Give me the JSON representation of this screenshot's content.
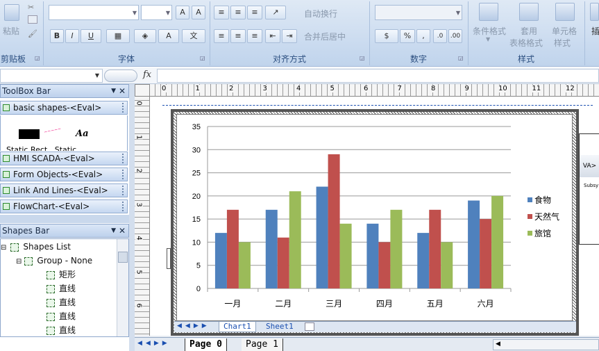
{
  "ribbon": {
    "clipboard": {
      "paste": "粘贴",
      "label": "剪贴板"
    },
    "font": {
      "label": "字体",
      "bold": "B",
      "italic": "I",
      "underline": "U"
    },
    "alignment": {
      "wrap_text": "自动换行",
      "merge_center": "合并后居中",
      "label": "对齐方式"
    },
    "number": {
      "percent": "%",
      "label": "数字"
    },
    "styles": {
      "conditional": "条件格式",
      "table": "套用",
      "table2": "表格格式",
      "cell": "单元格",
      "cell2": "样式",
      "label": "样式"
    },
    "insert": "插"
  },
  "formula_bar": {
    "fx": "fx"
  },
  "toolbox": {
    "title": "ToolBox Bar",
    "items": [
      {
        "label": "basic shapes-<Eval>"
      },
      {
        "label": "HMI SCADA-<Eval>"
      },
      {
        "label": "Form Objects-<Eval>"
      },
      {
        "label": "Link And Lines-<Eval>"
      },
      {
        "label": "FlowChart-<Eval>"
      }
    ],
    "preview_text": "Aa",
    "preview_caption": "Static Rect   Static"
  },
  "shapes": {
    "title": "Shapes Bar",
    "list": "Shapes List",
    "group": "Group - None",
    "children": [
      "矩形",
      "直线",
      "直线",
      "直线",
      "直线"
    ]
  },
  "ruler": {
    "h": [
      "0",
      "1",
      "2",
      "3",
      "4",
      "5",
      "6",
      "7",
      "8",
      "9",
      "10",
      "11",
      "12"
    ],
    "v": [
      "0",
      "1",
      "2",
      "3",
      "4",
      "5",
      "6"
    ]
  },
  "sheet_tabs": {
    "chart1": "Chart1",
    "sheet1": "Sheet1"
  },
  "page_tabs": {
    "page0": "Page  0",
    "page1": "Page  1"
  },
  "side_widget": {
    "vax": "VA>",
    "subsy": "Subsy"
  },
  "chart_data": {
    "type": "bar",
    "categories": [
      "一月",
      "二月",
      "三月",
      "四月",
      "五月",
      "六月"
    ],
    "series": [
      {
        "name": "食物",
        "values": [
          12,
          17,
          22,
          14,
          12,
          19
        ],
        "color": "#4f81bd"
      },
      {
        "name": "天然气",
        "values": [
          17,
          11,
          29,
          10,
          17,
          15
        ],
        "color": "#c0504d"
      },
      {
        "name": "旅馆",
        "values": [
          10,
          21,
          14,
          17,
          10,
          20
        ],
        "color": "#9bbb59"
      }
    ],
    "ylim": [
      0,
      35
    ],
    "yticks": [
      "0",
      "5",
      "10",
      "15",
      "20",
      "25",
      "30",
      "35"
    ],
    "grid": true,
    "legend": "right"
  }
}
